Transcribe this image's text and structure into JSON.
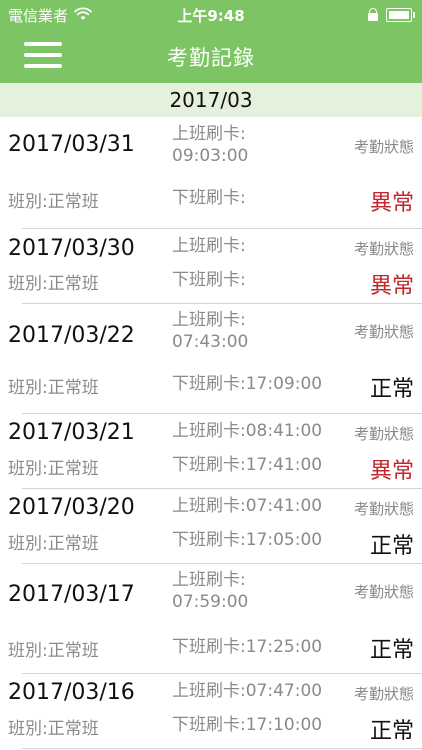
{
  "statusbar": {
    "carrier": "電信業者",
    "time": "上午9:48",
    "icons": [
      "wifi-icon",
      "lock-icon",
      "battery-icon"
    ]
  },
  "header": {
    "title": "考勤記錄",
    "menu_icon": "hamburger-menu-icon"
  },
  "month": "2017/03",
  "colors": {
    "header_green": "#7dc464",
    "month_bg": "#e6f1dd",
    "abnormal_red": "#c0282d"
  },
  "records": [
    {
      "date": "2017/03/31",
      "shift": "班別:正常班",
      "clock_in": "上班刷卡:\n09:03:00",
      "clock_out": "下班刷卡:",
      "status_label": "考勤狀態",
      "status": "異常"
    },
    {
      "date": "2017/03/30",
      "shift": "班別:正常班",
      "clock_in": "上班刷卡:",
      "clock_out": "下班刷卡:",
      "status_label": "考勤狀態",
      "status": "異常"
    },
    {
      "date": "2017/03/22",
      "shift": "班別:正常班",
      "clock_in": "上班刷卡:\n07:43:00",
      "clock_out": "下班刷卡:17:09:00",
      "status_label": "考勤狀態",
      "status": "正常"
    },
    {
      "date": "2017/03/21",
      "shift": "班別:正常班",
      "clock_in": "上班刷卡:08:41:00",
      "clock_out": "下班刷卡:17:41:00",
      "status_label": "考勤狀態",
      "status": "異常"
    },
    {
      "date": "2017/03/20",
      "shift": "班別:正常班",
      "clock_in": "上班刷卡:07:41:00",
      "clock_out": "下班刷卡:17:05:00",
      "status_label": "考勤狀態",
      "status": "正常"
    },
    {
      "date": "2017/03/17",
      "shift": "班別:正常班",
      "clock_in": "上班刷卡:\n07:59:00",
      "clock_out": "下班刷卡:17:25:00",
      "status_label": "考勤狀態",
      "status": "正常"
    },
    {
      "date": "2017/03/16",
      "shift": "班別:正常班",
      "clock_in": "上班刷卡:07:47:00",
      "clock_out": "下班刷卡:17:10:00",
      "status_label": "考勤狀態",
      "status": "正常"
    }
  ]
}
